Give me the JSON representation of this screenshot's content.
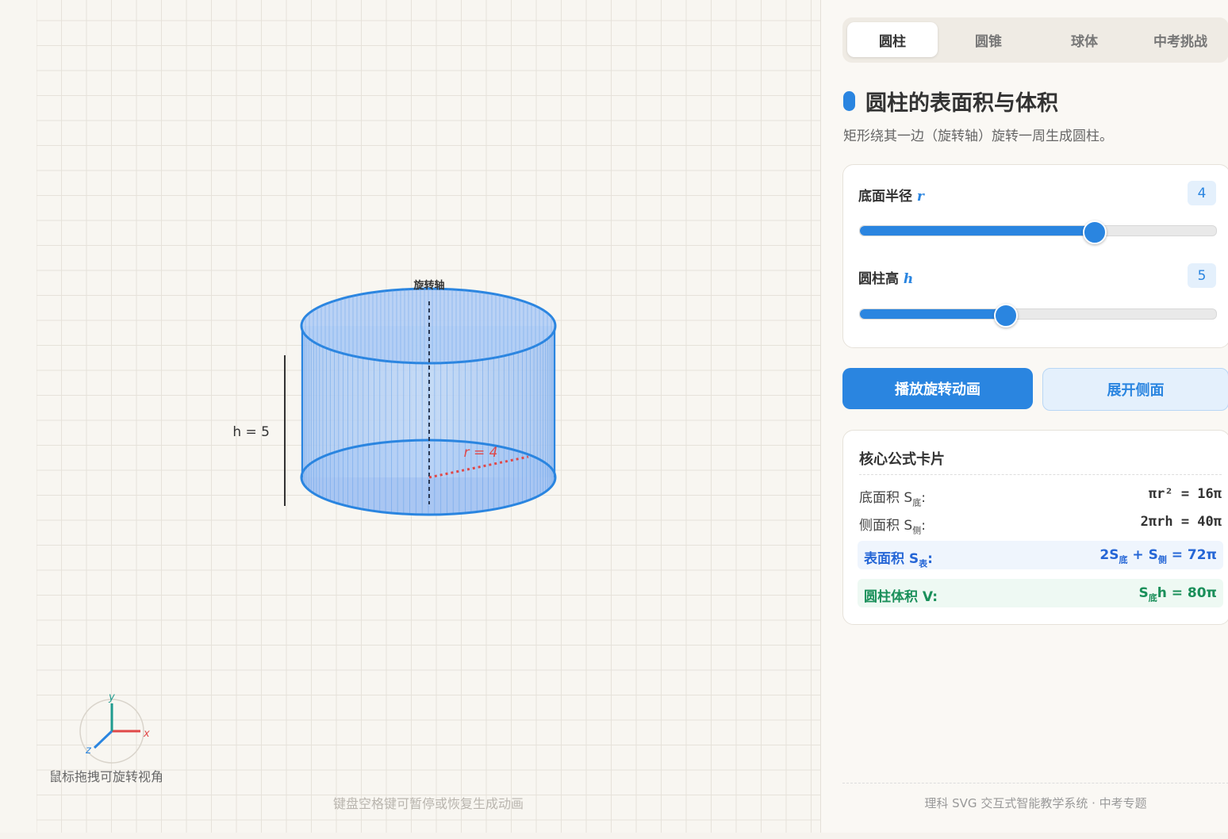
{
  "canvas": {
    "axis_label": "旋转轴",
    "height_label": "h = 5",
    "radius_label": "r = 4",
    "gizmo": {
      "x": "x",
      "y": "y",
      "z": "z"
    },
    "hint_drag": "鼠标拖拽可旋转视角",
    "hint_keyboard": "键盘空格键可暂停或恢复生成动画"
  },
  "tabs": [
    {
      "label": "圆柱",
      "active": true
    },
    {
      "label": "圆锥",
      "active": false
    },
    {
      "label": "球体",
      "active": false
    },
    {
      "label": "中考挑战",
      "active": false
    }
  ],
  "header": {
    "title": "圆柱的表面积与体积",
    "subtitle": "矩形绕其一边（旋转轴）旋转一周生成圆柱。"
  },
  "params": {
    "radius": {
      "label": "底面半径 ",
      "symbol": "r",
      "value": "4",
      "fraction": 0.655
    },
    "height": {
      "label": "圆柱高 ",
      "symbol": "h",
      "value": "5",
      "fraction": 0.405
    }
  },
  "buttons": {
    "play": "播放旋转动画",
    "unfold": "展开侧面"
  },
  "formulas": {
    "title": "核心公式卡片",
    "base_area": {
      "label": "底面积 S",
      "sub": "底",
      "colon": ":",
      "expr": "πr² = 16π"
    },
    "lateral_area": {
      "label": "侧面积 S",
      "sub": "侧",
      "colon": ":",
      "expr": "2πrh = 40π"
    },
    "surface_area": {
      "label": "表面积 S",
      "sub": "表",
      "colon": ":",
      "expr_a": "2S",
      "sub_a": "底",
      "expr_b": " + S",
      "sub_b": "侧",
      "expr_c": " = 72π"
    },
    "volume": {
      "label": "圆柱体积 V:",
      "expr_a": "S",
      "sub_a": "底",
      "expr_b": "h = 80π"
    }
  },
  "footer": "理科 SVG 交互式智能教学系统 · 中考专题",
  "colors": {
    "accent": "#2a85e0",
    "radius_red": "#e04848",
    "surface_blue": "#2566d6",
    "volume_green": "#1a8f5a"
  }
}
